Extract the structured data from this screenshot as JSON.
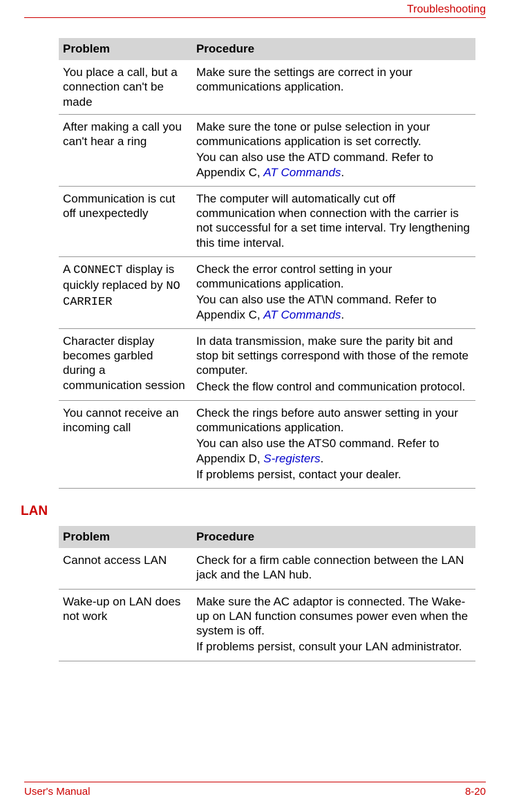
{
  "header": {
    "section": "Troubleshooting"
  },
  "footer": {
    "left": "User's Manual",
    "right": "8-20"
  },
  "table1": {
    "col_problem": "Problem",
    "col_procedure": "Procedure",
    "rows": [
      {
        "problem_text": "You place a call, but a connection can't be made",
        "proc1": "Make sure the settings are correct in your communications application."
      },
      {
        "problem_text": "After making a call you can't hear a ring",
        "proc1": "Make sure the tone or pulse selection in your communications application is set correctly.",
        "proc2_pre": "You can also use the ATD command. Refer to Appendix C, ",
        "proc2_link": "AT Commands",
        "proc2_post": "."
      },
      {
        "problem_text": "Communication is cut off unexpectedly",
        "proc1": "The computer will automatically cut off communication when connection with the carrier is not successful for a set time interval. Try lengthening this time interval."
      },
      {
        "problem_pre": "A ",
        "problem_mono1": "CONNECT",
        "problem_mid": " display is quickly replaced by ",
        "problem_mono2": "NO CARRIER",
        "proc1": "Check the error control setting in your communications application.",
        "proc2_pre": "You can also use the AT\\N command. Refer to Appendix C, ",
        "proc2_link": "AT Commands",
        "proc2_post": "."
      },
      {
        "problem_text": "Character display becomes garbled during a communication session",
        "proc1": "In data transmission, make sure the parity bit and stop bit settings correspond with those of the remote computer.",
        "proc2": "Check the flow control and communication protocol."
      },
      {
        "problem_text": "You cannot receive an incoming call",
        "proc1": "Check the rings before auto answer setting in your communications application.",
        "proc2_pre": "You can also use the ATS0 command. Refer to Appendix D, ",
        "proc2_link": "S-registers",
        "proc2_post": ".",
        "proc3": "If problems persist, contact your dealer."
      }
    ]
  },
  "section2_heading": "LAN",
  "table2": {
    "col_problem": "Problem",
    "col_procedure": "Procedure",
    "rows": [
      {
        "problem_text": "Cannot access LAN",
        "proc1": "Check for a firm cable connection between the LAN jack and the LAN hub."
      },
      {
        "problem_text": "Wake-up on LAN does not work",
        "proc1": "Make sure the AC adaptor is connected. The Wake-up on LAN function consumes power even when the system is off.",
        "proc2": "If problems persist, consult your LAN administrator."
      }
    ]
  }
}
